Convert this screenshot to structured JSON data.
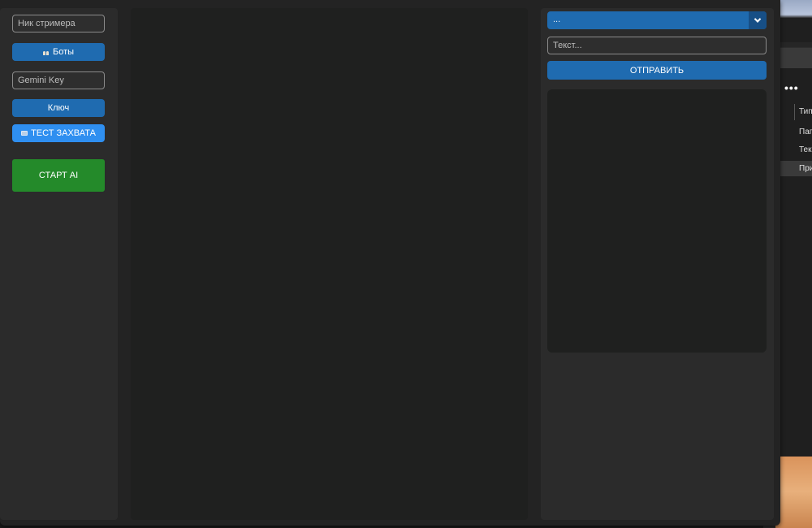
{
  "left_panel": {
    "streamer_nick": {
      "placeholder": "Ник стримера",
      "value": ""
    },
    "bots_button": {
      "label": "Боты",
      "icon": "people-icon"
    },
    "gemini_key": {
      "placeholder": "Gemini Key",
      "value": ""
    },
    "key_button": {
      "label": "Ключ"
    },
    "capture_test_button": {
      "label": "ТЕСТ ЗАХВАТА",
      "icon": "camera-icon"
    },
    "start_ai_button": {
      "label": "СТАРТ AI"
    }
  },
  "right_panel": {
    "dropdown": {
      "value": "..."
    },
    "message_input": {
      "placeholder": "Текст...",
      "value": ""
    },
    "send_button": {
      "label": "ОТПРАВИТЬ"
    }
  },
  "background_window": {
    "menu": "•••",
    "rows": [
      "Тип",
      "Пап",
      "Тек",
      "При"
    ]
  },
  "colors": {
    "primary_button": "#1f6bb0",
    "capture_button": "#2f8ff0",
    "start_button": "#248a2a",
    "panel": "#2b2b2b",
    "content_area": "#1f201f"
  }
}
